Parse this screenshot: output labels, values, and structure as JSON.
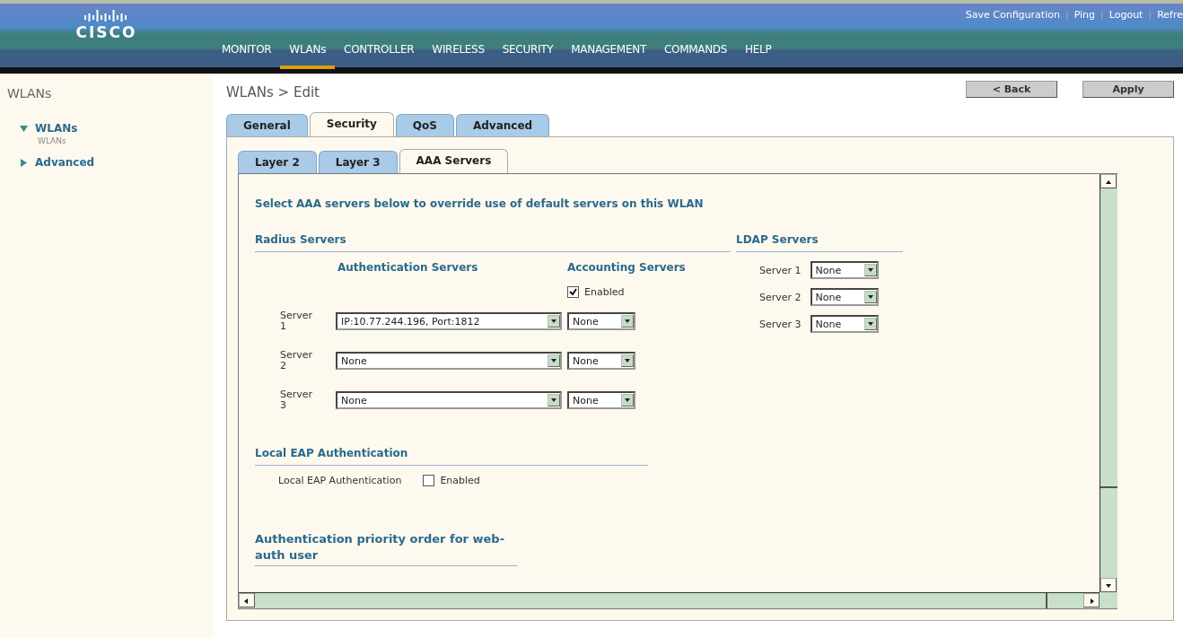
{
  "header": {
    "logo_text": "CISCO",
    "links": [
      {
        "kind": "link",
        "text": "Save Configuration"
      },
      {
        "kind": "separator",
        "text": "|"
      },
      {
        "kind": "link",
        "text": "Ping"
      },
      {
        "kind": "separator",
        "text": "|"
      },
      {
        "kind": "link",
        "text": "Logout"
      },
      {
        "kind": "separator",
        "text": "|"
      },
      {
        "kind": "link",
        "text": "Refre"
      }
    ],
    "nav": [
      {
        "label": "MONITOR",
        "selected": false
      },
      {
        "label": "WLANs",
        "selected": true
      },
      {
        "label": "CONTROLLER",
        "selected": false
      },
      {
        "label": "WIRELESS",
        "selected": false
      },
      {
        "label": "SECURITY",
        "selected": false
      },
      {
        "label": "MANAGEMENT",
        "selected": false
      },
      {
        "label": "COMMANDS",
        "selected": false
      },
      {
        "label": "HELP",
        "selected": false
      }
    ]
  },
  "sidebar": {
    "title": "WLANs",
    "items": [
      {
        "label": "WLANs",
        "expanded": true,
        "children": [
          {
            "label": "WLANs"
          }
        ]
      },
      {
        "label": "Advanced",
        "expanded": false
      }
    ]
  },
  "main": {
    "title": "WLANs > Edit",
    "buttons": [
      "< Back",
      "Apply"
    ],
    "tabs": [
      {
        "label": "General",
        "selected": false
      },
      {
        "label": "Security",
        "selected": true
      },
      {
        "label": "QoS",
        "selected": false
      },
      {
        "label": "Advanced",
        "selected": false
      }
    ],
    "subtabs": [
      {
        "label": "Layer 2",
        "selected": false
      },
      {
        "label": "Layer 3",
        "selected": false
      },
      {
        "label": "AAA Servers",
        "selected": true
      }
    ],
    "form": {
      "intro": "Select AAA servers below to override use of default servers on this WLAN",
      "radius": {
        "title": "Radius Servers",
        "auth_header": "Authentication Servers",
        "acct_header": "Accounting Servers",
        "acct_enabled": {
          "label": "Enabled",
          "checked": true
        },
        "rows": [
          {
            "label": "Server 1",
            "auth": "IP:10.77.244.196, Port:1812",
            "acct": "None"
          },
          {
            "label": "Server 2",
            "auth": "None",
            "acct": "None"
          },
          {
            "label": "Server 3",
            "auth": "None",
            "acct": "None"
          }
        ]
      },
      "ldap": {
        "title": "LDAP Servers",
        "rows": [
          {
            "label": "Server 1",
            "value": "None"
          },
          {
            "label": "Server 2",
            "value": "None"
          },
          {
            "label": "Server 3",
            "value": "None"
          }
        ]
      },
      "local_eap": {
        "title": "Local EAP Authentication",
        "label": "Local EAP Authentication",
        "option": {
          "label": "Enabled",
          "checked": false
        }
      },
      "priority": {
        "title": "Authentication priority order for web-auth user"
      }
    }
  }
}
